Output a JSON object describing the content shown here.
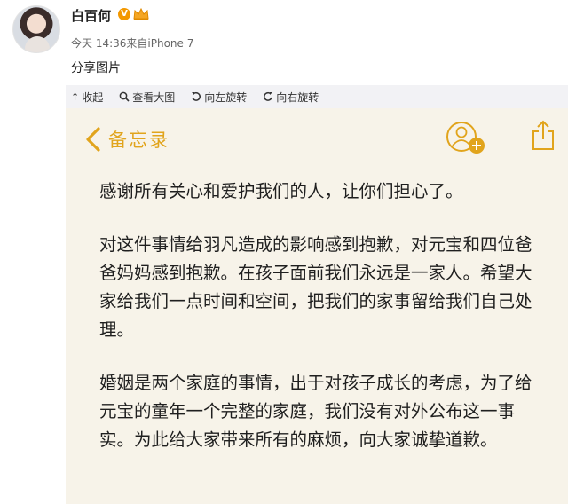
{
  "post": {
    "username": "白百何",
    "vip_badge": "V",
    "meta": "今天 14:36来自iPhone 7",
    "share_text": "分享图片"
  },
  "toolbar": {
    "collapse": "收起",
    "view_large": "查看大图",
    "rotate_left": "向左旋转",
    "rotate_right": "向右旋转"
  },
  "memo": {
    "back_label": "备忘录",
    "accent": "#e1a41c",
    "paragraphs": [
      "感谢所有关心和爱护我们的人，让你们担心了。",
      "对这件事情给羽凡造成的影响感到抱歉，对元宝和四位爸爸妈妈感到抱歉。在孩子面前我们永远是一家人。希望大家给我们一点时间和空间，把我们的家事留给我们自己处理。",
      "婚姻是两个家庭的事情，出于对孩子成长的考虑，为了给元宝的童年一个完整的家庭，我们没有对外公布这一事实。为此给大家带来所有的麻烦，向大家诚挚道歉。"
    ]
  }
}
